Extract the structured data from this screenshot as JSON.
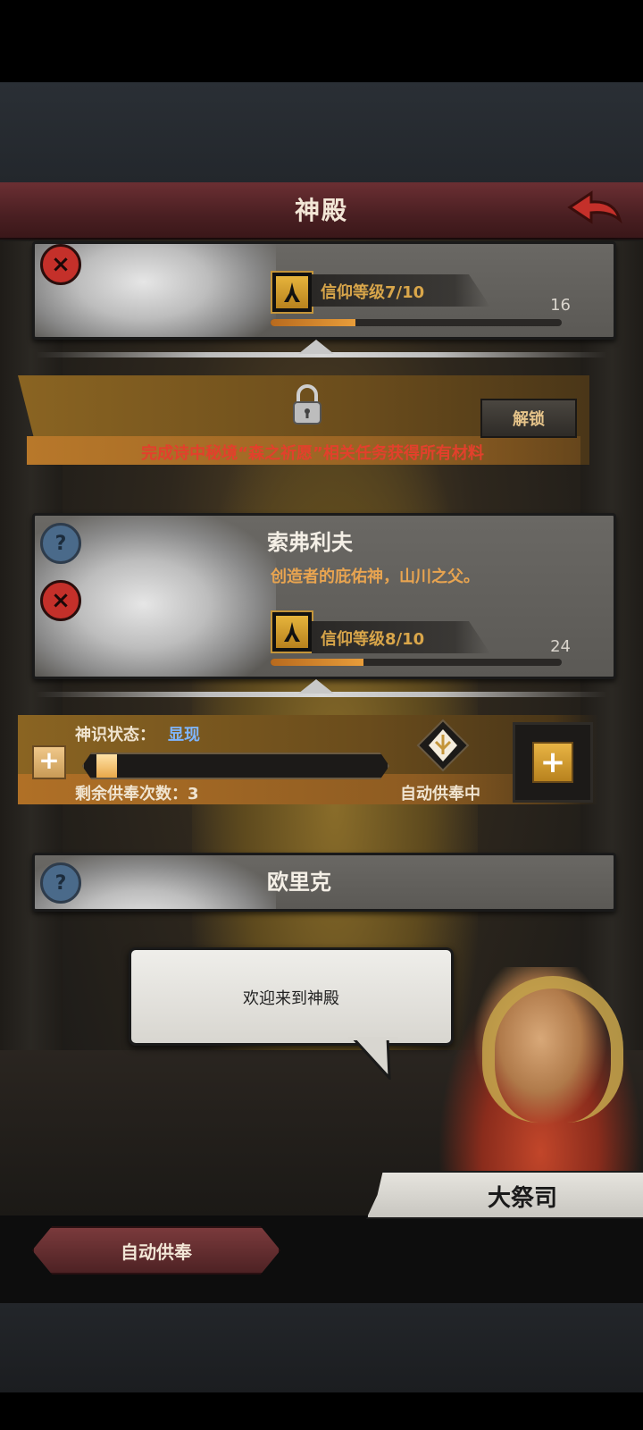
{
  "header": {
    "title": "神殿"
  },
  "cards": [
    {
      "faith_label": "信仰等级7/10",
      "points": "16",
      "progress": 0.29
    },
    {
      "name": "索弗利夫",
      "desc": "创造者的庇佑神，山川之父。",
      "faith_label": "信仰等级8/10",
      "points": "24",
      "progress": 0.32
    },
    {
      "name": "欧里克"
    }
  ],
  "unlock": {
    "button_label": "解锁",
    "requirement": "完成诗中秘境“森之祈愿”相关任务获得所有材料"
  },
  "status": {
    "divine_label": "神识状态：",
    "divine_value": "显现",
    "divine_progress": 0.07,
    "remaining_label": "剩余供奉次数：3",
    "auto_state": "自动供奉中",
    "plus_small": "+",
    "plus_big": "+"
  },
  "dialog": {
    "text": "欢迎来到神殿",
    "speaker": "大祭司"
  },
  "bottom": {
    "auto_offer_button": "自动供奉"
  },
  "icons": {
    "back": "back-arrow-icon",
    "lock": "lock-icon",
    "help": "question-icon",
    "close": "close-x-icon",
    "faith": "faith-hands-icon",
    "auto": "temple-emblem-icon"
  },
  "colors": {
    "accent_gold": "#d9a64a",
    "header_red": "#6b2f33",
    "requirement_red": "#e2402c",
    "divine_blue": "#7fb6ff"
  }
}
